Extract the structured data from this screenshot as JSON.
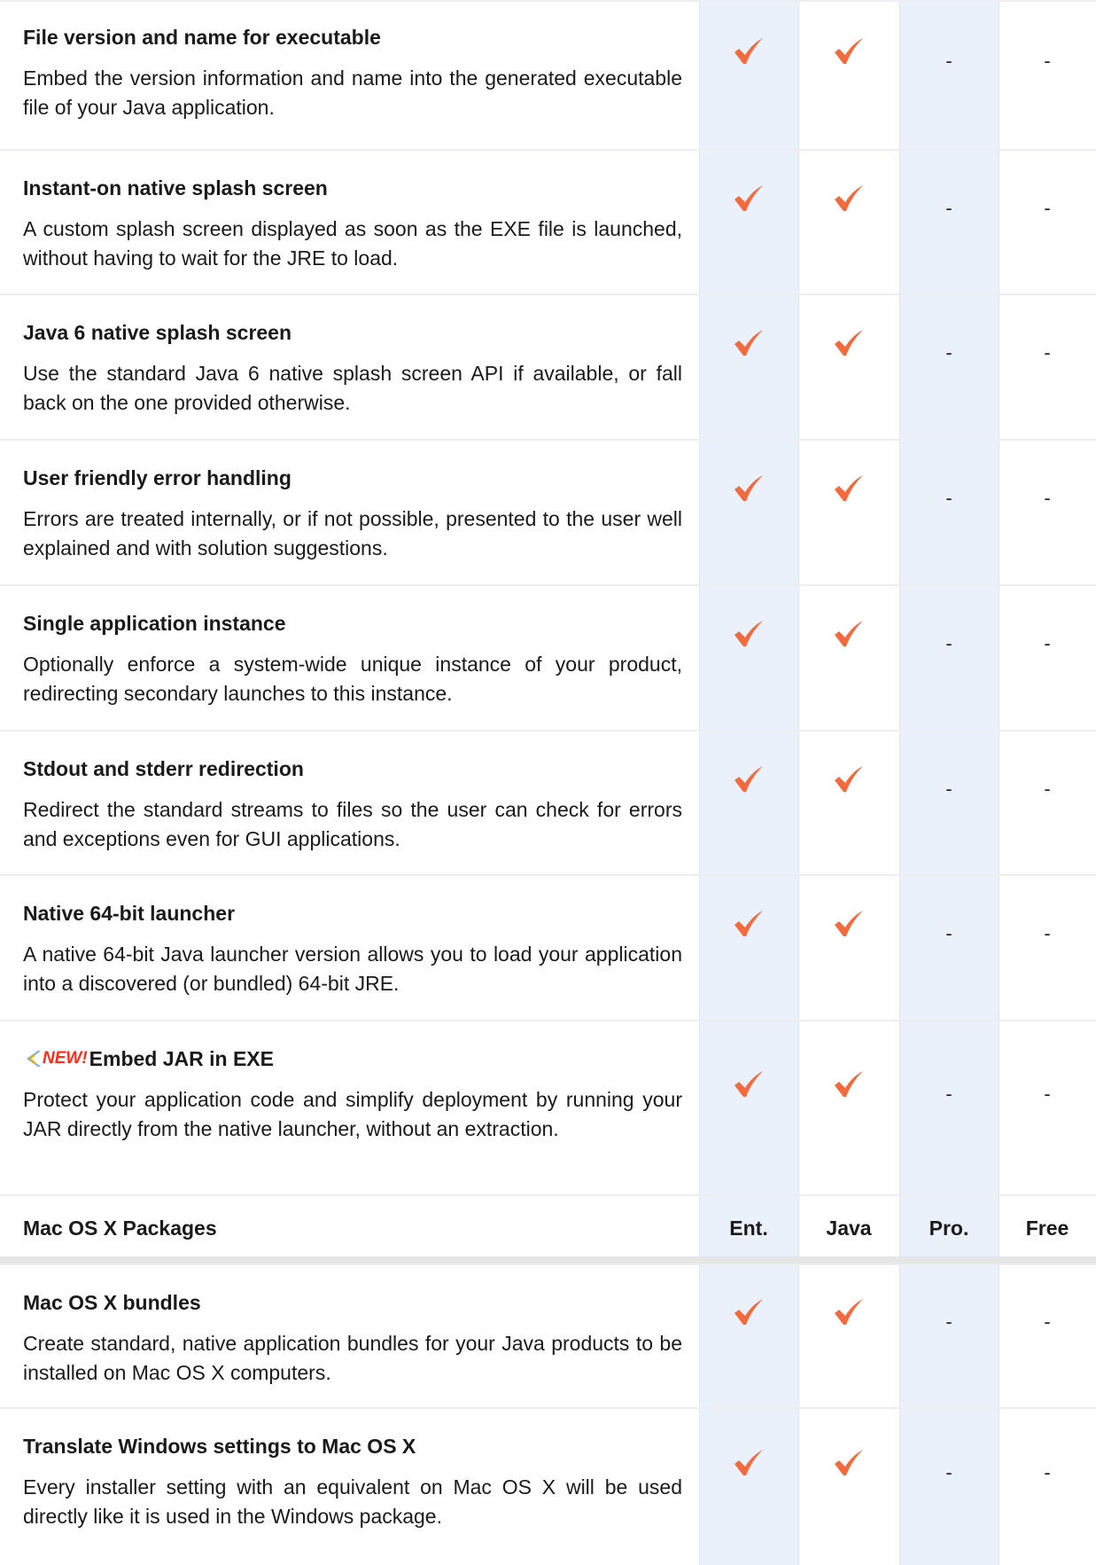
{
  "features_a": [
    {
      "title": "File version and name for executable",
      "desc": "Embed the version information and name into the generated executable file of your Java application.",
      "marks": [
        "check",
        "check",
        "-",
        "-"
      ]
    },
    {
      "title": "Instant-on native splash screen",
      "desc": "A custom splash screen displayed as soon as the EXE file is launched, without having to wait for the JRE to load.",
      "marks": [
        "check",
        "check",
        "-",
        "-"
      ]
    },
    {
      "title": "Java 6 native splash screen",
      "desc": "Use the standard Java 6 native splash screen API if available, or fall back on the one provided otherwise.",
      "marks": [
        "check",
        "check",
        "-",
        "-"
      ]
    },
    {
      "title": "User friendly error handling",
      "desc": "Errors are treated internally, or if not possible, presented to the user well explained and with solution suggestions.",
      "marks": [
        "check",
        "check",
        "-",
        "-"
      ]
    },
    {
      "title": "Single application instance",
      "desc": "Optionally enforce a system-wide unique instance of your product, redirecting secondary launches to this instance.",
      "marks": [
        "check",
        "check",
        "-",
        "-"
      ]
    },
    {
      "title": "Stdout and stderr redirection",
      "desc": "Redirect the standard streams to files so the user can check for errors and exceptions even for GUI applications.",
      "marks": [
        "check",
        "check",
        "-",
        "-"
      ]
    },
    {
      "title": "Native 64-bit launcher",
      "desc": "A native 64-bit Java launcher version allows you to load your application into a discovered (or bundled) 64-bit JRE.",
      "marks": [
        "check",
        "check",
        "-",
        "-"
      ]
    },
    {
      "badge": "NEW!",
      "title": "Embed JAR in EXE",
      "desc": "Protect your application code and simplify deployment by running your JAR directly from the native launcher, without an extraction.",
      "marks": [
        "check",
        "check",
        "-",
        "-"
      ]
    }
  ],
  "section": {
    "label": "Mac OS X Packages",
    "columns": [
      "Ent.",
      "Java",
      "Pro.",
      "Free"
    ]
  },
  "features_b": [
    {
      "title": "Mac OS X bundles",
      "desc": "Create standard, native application bundles for your Java products to be installed on Mac OS X computers.",
      "marks": [
        "check",
        "check",
        "-",
        "-"
      ]
    },
    {
      "title": "Translate Windows settings to Mac OS X",
      "desc": "Every installer setting with an equivalent on Mac OS X will be used directly like it is used in the Windows package.",
      "marks": [
        "check",
        "check",
        "-",
        "-"
      ]
    }
  ],
  "colors": {
    "check": "#f26a3d",
    "shade": "#eaf1fa",
    "badge": "#ff2a1a"
  },
  "icons": {
    "check": "check-icon",
    "badge": "new-badge-icon"
  }
}
